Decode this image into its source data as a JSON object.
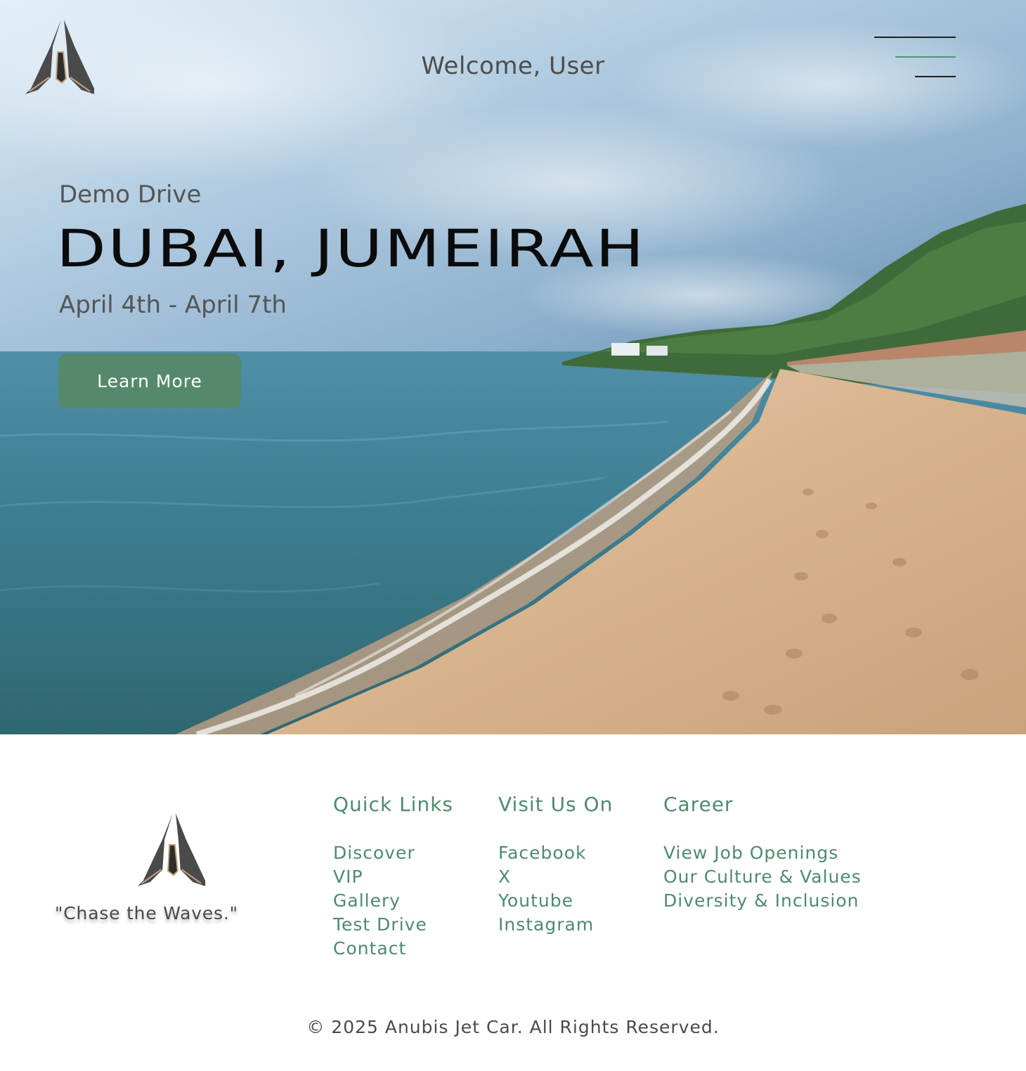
{
  "header": {
    "welcome": "Welcome, User",
    "logo_icon": "anubis-logo-icon",
    "menu_icon": "hamburger-menu-icon"
  },
  "hero": {
    "kicker": "Demo Drive",
    "title": "DUBAI, JUMEIRAH",
    "dates": "April 4th - April 7th",
    "cta_label": "Learn More"
  },
  "footer": {
    "tagline": "\"Chase the Waves.\"",
    "quick_links": {
      "heading": "Quick Links",
      "items": [
        "Discover",
        "VIP",
        "Gallery",
        "Test Drive",
        "Contact"
      ]
    },
    "visit_us": {
      "heading": "Visit Us On",
      "items": [
        "Facebook",
        "X",
        "Youtube",
        "Instagram"
      ]
    },
    "career": {
      "heading": "Career",
      "items": [
        "View Job Openings",
        "Our Culture & Values",
        "Diversity & Inclusion"
      ]
    },
    "copyright": "© 2025 Anubis Jet Car. All Rights Reserved."
  },
  "colors": {
    "accent_green": "#55896c",
    "link_green": "#4f8a6d",
    "text_gray": "#555555",
    "title_black": "#0b0b0b"
  }
}
